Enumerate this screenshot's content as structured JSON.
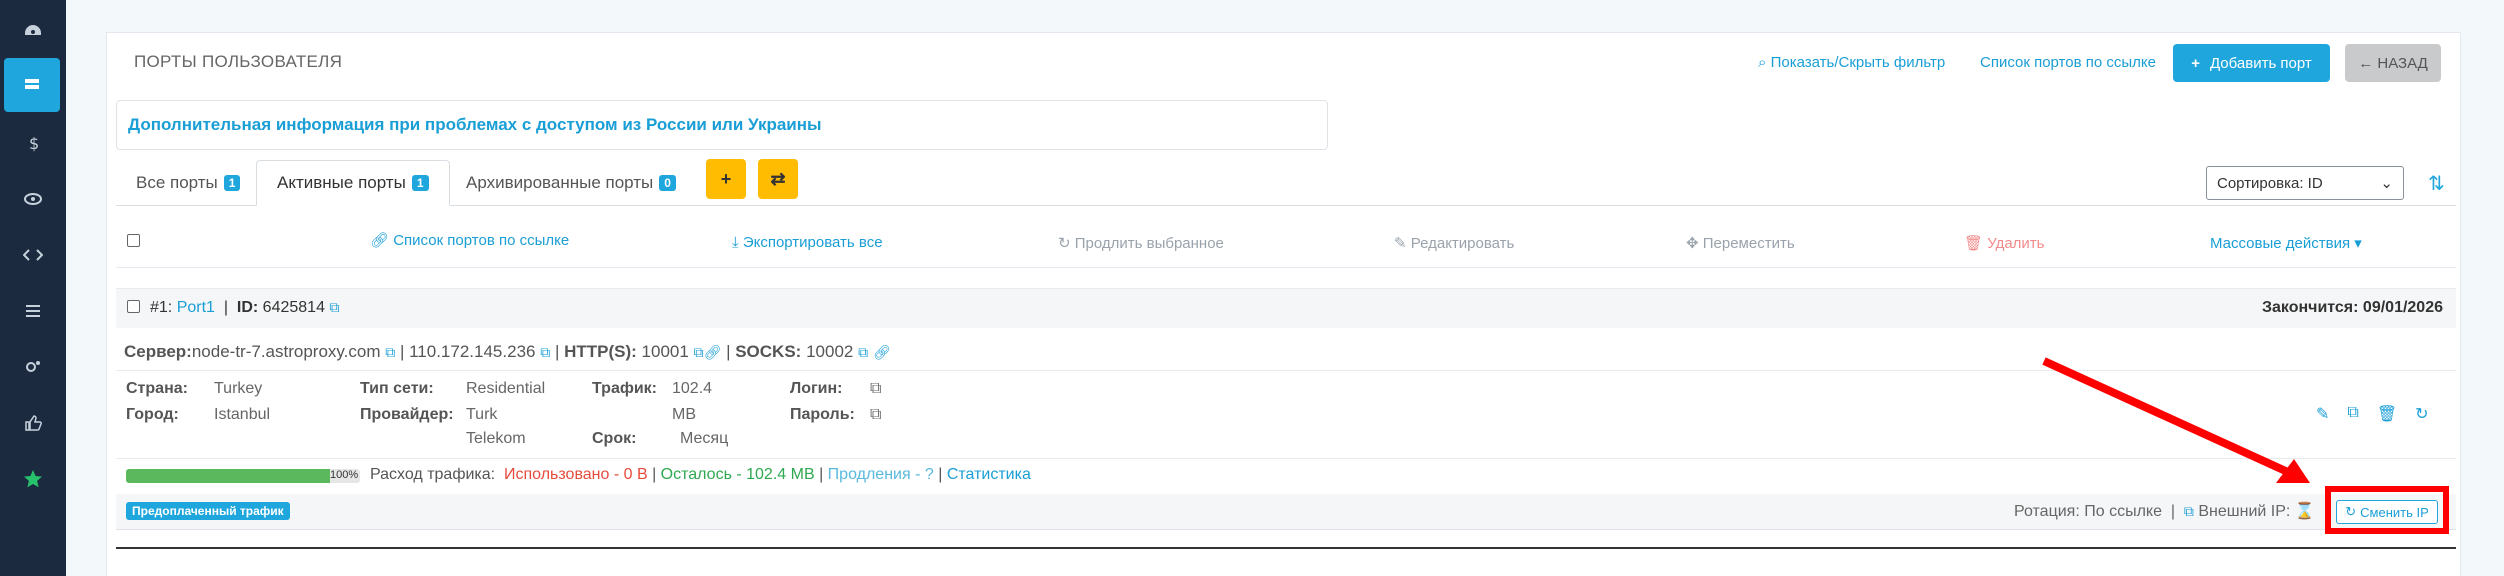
{
  "sidebar": {
    "icons": [
      "dashboard-icon",
      "servers-icon",
      "dollar-icon",
      "eye-icon",
      "code-icon",
      "list-icon",
      "settings-icon",
      "thumbs-up-icon",
      "star-icon"
    ]
  },
  "header": {
    "title": "ПОРТЫ ПОЛЬЗОВАТЕЛЯ",
    "filter_link": "Показать/Скрыть фильтр",
    "ports_by_link": "Список портов по ссылке",
    "add_button": "Добавить порт",
    "back_button": "← НАЗАД"
  },
  "info": {
    "text": "Дополнительная информация при проблемах с доступом из России или Украины"
  },
  "tabs": [
    {
      "label": "Все порты",
      "count": "1"
    },
    {
      "label": "Активные порты",
      "count": "1"
    },
    {
      "label": "Архивированные порты",
      "count": "0"
    }
  ],
  "sort": {
    "label": "Сортировка: ID"
  },
  "actions": {
    "ports_by_link": "Список портов по ссылке",
    "export_all": "Экспортировать все",
    "extend_selected": "Продлить выбранное",
    "edit": "Редактировать",
    "move": "Переместить",
    "delete": "Удалить",
    "mass_actions": "Массовые действия"
  },
  "port": {
    "number": "#1:",
    "name": "Port1",
    "id_label": "ID:",
    "id": "6425814",
    "ends_label": "Закончится:",
    "ends": "09/01/2026",
    "server_label": "Сервер:",
    "server": "node-tr-7.astroproxy.com",
    "ip": "110.172.145.236",
    "http_label": "HTTP(S):",
    "http_port": "10001",
    "socks_label": "SOCKS:",
    "socks_port": "10002",
    "country_label": "Страна:",
    "country": "Turkey",
    "city_label": "Город:",
    "city": "Istanbul",
    "net_type_label": "Тип сети:",
    "net_type": "Residential",
    "provider_label": "Провайдер:",
    "provider_line1": "Turk",
    "provider_line2": "Telekom",
    "traffic_label": "Трафик:",
    "traffic_line1": "102.4",
    "traffic_line2": "MB",
    "term_label": "Срок:",
    "term": "Месяц",
    "login_label": "Логин:",
    "password_label": "Пароль:",
    "progress_percent": 100,
    "progress_text": "100%",
    "traffic_usage_label": "Расход трафика:",
    "used": "Использовано - 0 B",
    "left": "Осталось - 102.4 MB",
    "extensions": "Продления -",
    "stats": "Статистика",
    "prepaid_badge": "Предоплаченный трафик",
    "rotation": "Ротация: По ссылке",
    "external_ip": "Внешний IP:",
    "change_ip": "Сменить IP"
  },
  "colors": {
    "sidebar": "#1b2a3f",
    "accent": "#1fa7dd",
    "warning": "#ffbc00",
    "highlight": "#ff0000"
  }
}
